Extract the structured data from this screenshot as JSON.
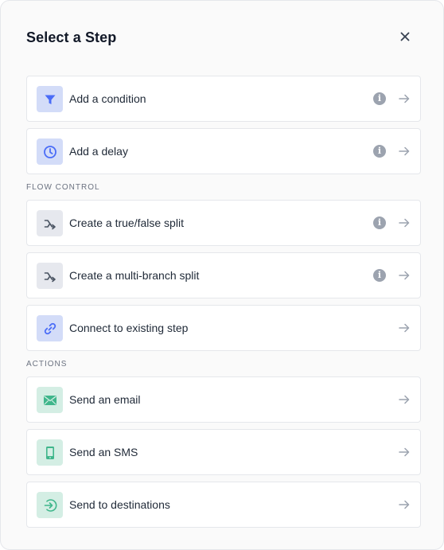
{
  "dialog": {
    "title": "Select a Step",
    "close_icon": "close-icon"
  },
  "sections": [
    {
      "label": "",
      "items": [
        {
          "label": "Add a condition",
          "icon": "filter-icon",
          "has_info": true
        },
        {
          "label": "Add a delay",
          "icon": "clock-icon",
          "has_info": true
        }
      ]
    },
    {
      "label": "FLOW CONTROL",
      "items": [
        {
          "label": "Create a true/false split",
          "icon": "split-icon",
          "has_info": true
        },
        {
          "label": "Create a multi-branch split",
          "icon": "split-icon",
          "has_info": true
        },
        {
          "label": "Connect to existing step",
          "icon": "link-icon",
          "has_info": false
        }
      ]
    },
    {
      "label": "ACTIONS",
      "items": [
        {
          "label": "Send an email",
          "icon": "email-icon",
          "has_info": false
        },
        {
          "label": "Send an SMS",
          "icon": "phone-icon",
          "has_info": false
        },
        {
          "label": "Send to destinations",
          "icon": "destination-icon",
          "has_info": false
        }
      ]
    }
  ],
  "info_glyph": "i",
  "colors": {
    "blue_icon": "#4a6cf7",
    "blue_tile": "#d3dcf8",
    "gray_icon": "#4b5563",
    "gray_tile": "#e6e8ee",
    "green_icon": "#3fb68b",
    "green_tile": "#d4eee4",
    "muted": "#9ca3af"
  }
}
